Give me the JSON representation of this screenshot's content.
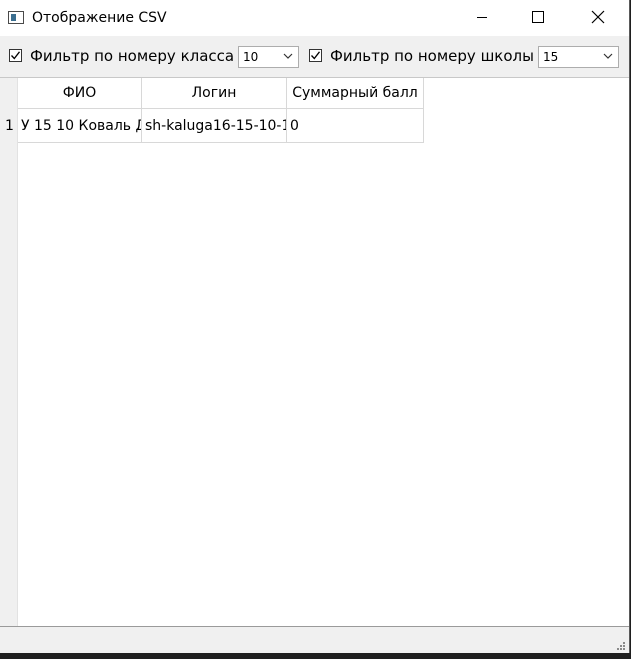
{
  "window": {
    "title": "Отображение CSV"
  },
  "toolbar": {
    "class_filter": {
      "label": "Фильтр по номеру класса",
      "checked": true,
      "value": "10"
    },
    "school_filter": {
      "label": "Фильтр по номеру школы",
      "checked": true,
      "value": "15"
    }
  },
  "table": {
    "columns": [
      "ФИО",
      "Логин",
      "Суммарный балл"
    ],
    "rows": [
      {
        "num": "1",
        "cells": [
          "У 15 10 Коваль Д",
          "sh-kaluga16-15-10-1",
          "0"
        ]
      }
    ]
  },
  "icons": {
    "app": "app-window-icon",
    "minimize": "minimize-icon",
    "maximize": "maximize-icon",
    "close": "close-icon",
    "check": "checkmark-icon",
    "dropdown": "chevron-down-icon",
    "grip": "size-grip-icon"
  }
}
